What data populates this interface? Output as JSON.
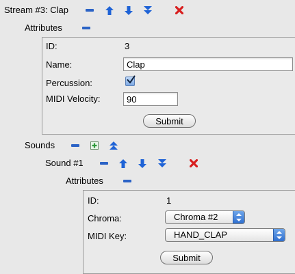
{
  "stream": {
    "title": "Stream #3: Clap",
    "attributes_label": "Attributes",
    "id_label": "ID:",
    "id_value": "3",
    "name_label": "Name:",
    "name_value": "Clap",
    "percussion_label": "Percussion:",
    "percussion_checked": true,
    "midi_velocity_label": "MIDI Velocity:",
    "midi_velocity_value": "90",
    "submit_label": "Submit"
  },
  "sounds": {
    "label": "Sounds",
    "sound1": {
      "title": "Sound #1",
      "attributes_label": "Attributes",
      "id_label": "ID:",
      "id_value": "1",
      "chroma_label": "Chroma:",
      "chroma_value": "Chroma #2",
      "midi_key_label": "MIDI Key:",
      "midi_key_value": "HAND_CLAP",
      "submit_label": "Submit"
    }
  },
  "icons": {
    "minus_color": "#2b63c6",
    "arrow_color": "#1f63d6",
    "delete_color": "#d81f1f",
    "add_color": "#2e9a3a"
  }
}
